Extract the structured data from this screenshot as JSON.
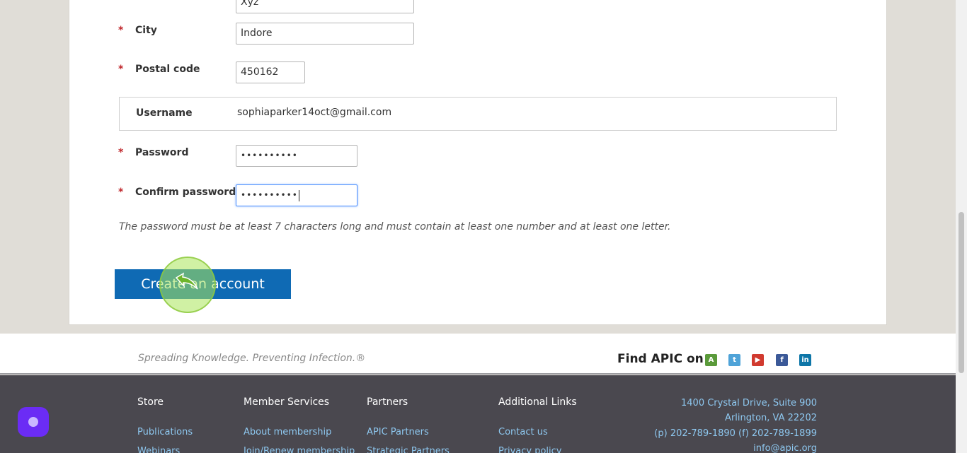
{
  "form": {
    "state_value": "Xyz",
    "city": {
      "label": "City",
      "value": "Indore"
    },
    "postal": {
      "label": "Postal code",
      "value": "450162"
    },
    "username": {
      "label": "Username",
      "value": "sophiaparker14oct@gmail.com"
    },
    "password": {
      "label": "Password",
      "value": "••••••••••"
    },
    "confirm": {
      "label": "Confirm password",
      "value": "••••••••••"
    },
    "required_mark": "*",
    "hint": "The password must be at least 7 characters long and must contain at least one number and at least one letter.",
    "submit_label": "Create an account"
  },
  "tagline_bar": {
    "tagline": "Spreading Knowledge. Preventing Infection.®",
    "find_label": "Find APIC on",
    "social": [
      {
        "icon": "apic-icon",
        "glyph": "A",
        "color": "#5a9a3a"
      },
      {
        "icon": "twitter-icon",
        "glyph": "t",
        "color": "#4fa3d8"
      },
      {
        "icon": "youtube-icon",
        "glyph": "▶",
        "color": "#d13a2f"
      },
      {
        "icon": "facebook-icon",
        "glyph": "f",
        "color": "#3b5998"
      },
      {
        "icon": "linkedin-icon",
        "glyph": "in",
        "color": "#0e76a8"
      }
    ]
  },
  "footer": {
    "columns": [
      {
        "title": "Store",
        "links": [
          "Publications",
          "Webinars"
        ]
      },
      {
        "title": "Member Services",
        "links": [
          "About membership",
          "Join/Renew membership"
        ]
      },
      {
        "title": "Partners",
        "links": [
          "APIC Partners",
          "Strategic Partners"
        ]
      },
      {
        "title": "Additional Links",
        "links": [
          "Contact us",
          "Privacy policy"
        ]
      }
    ],
    "address": {
      "line1": "1400 Crystal Drive, Suite 900",
      "line2": "Arlington, VA 22202",
      "phone": "(p) 202-789-1890 (f) 202-789-1899",
      "email": "info@apic.org"
    }
  }
}
